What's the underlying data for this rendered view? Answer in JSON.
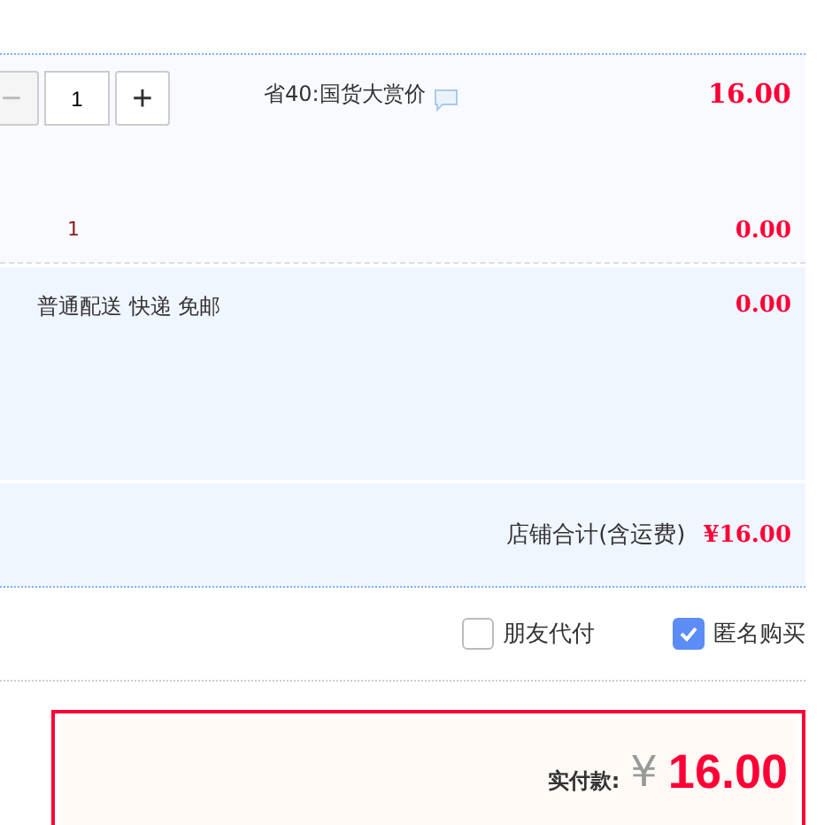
{
  "item": {
    "quantity": {
      "minus": "−",
      "value": "1",
      "plus": "+"
    },
    "promo": "省40:国货大赏价",
    "price": "16.00"
  },
  "item_sub": {
    "column_1": "1",
    "amount": "0.00"
  },
  "shipping": {
    "label": "普通配送 快递 免邮",
    "amount": "0.00"
  },
  "subtotal": {
    "label": "店铺合计(含运费)",
    "amount": "¥16.00"
  },
  "options": [
    {
      "label": "朋友代付",
      "checked": false
    },
    {
      "label": "匿名购买",
      "checked": true
    }
  ],
  "payment": {
    "label": "实付款:",
    "currency": "¥",
    "amount": "16.00"
  }
}
